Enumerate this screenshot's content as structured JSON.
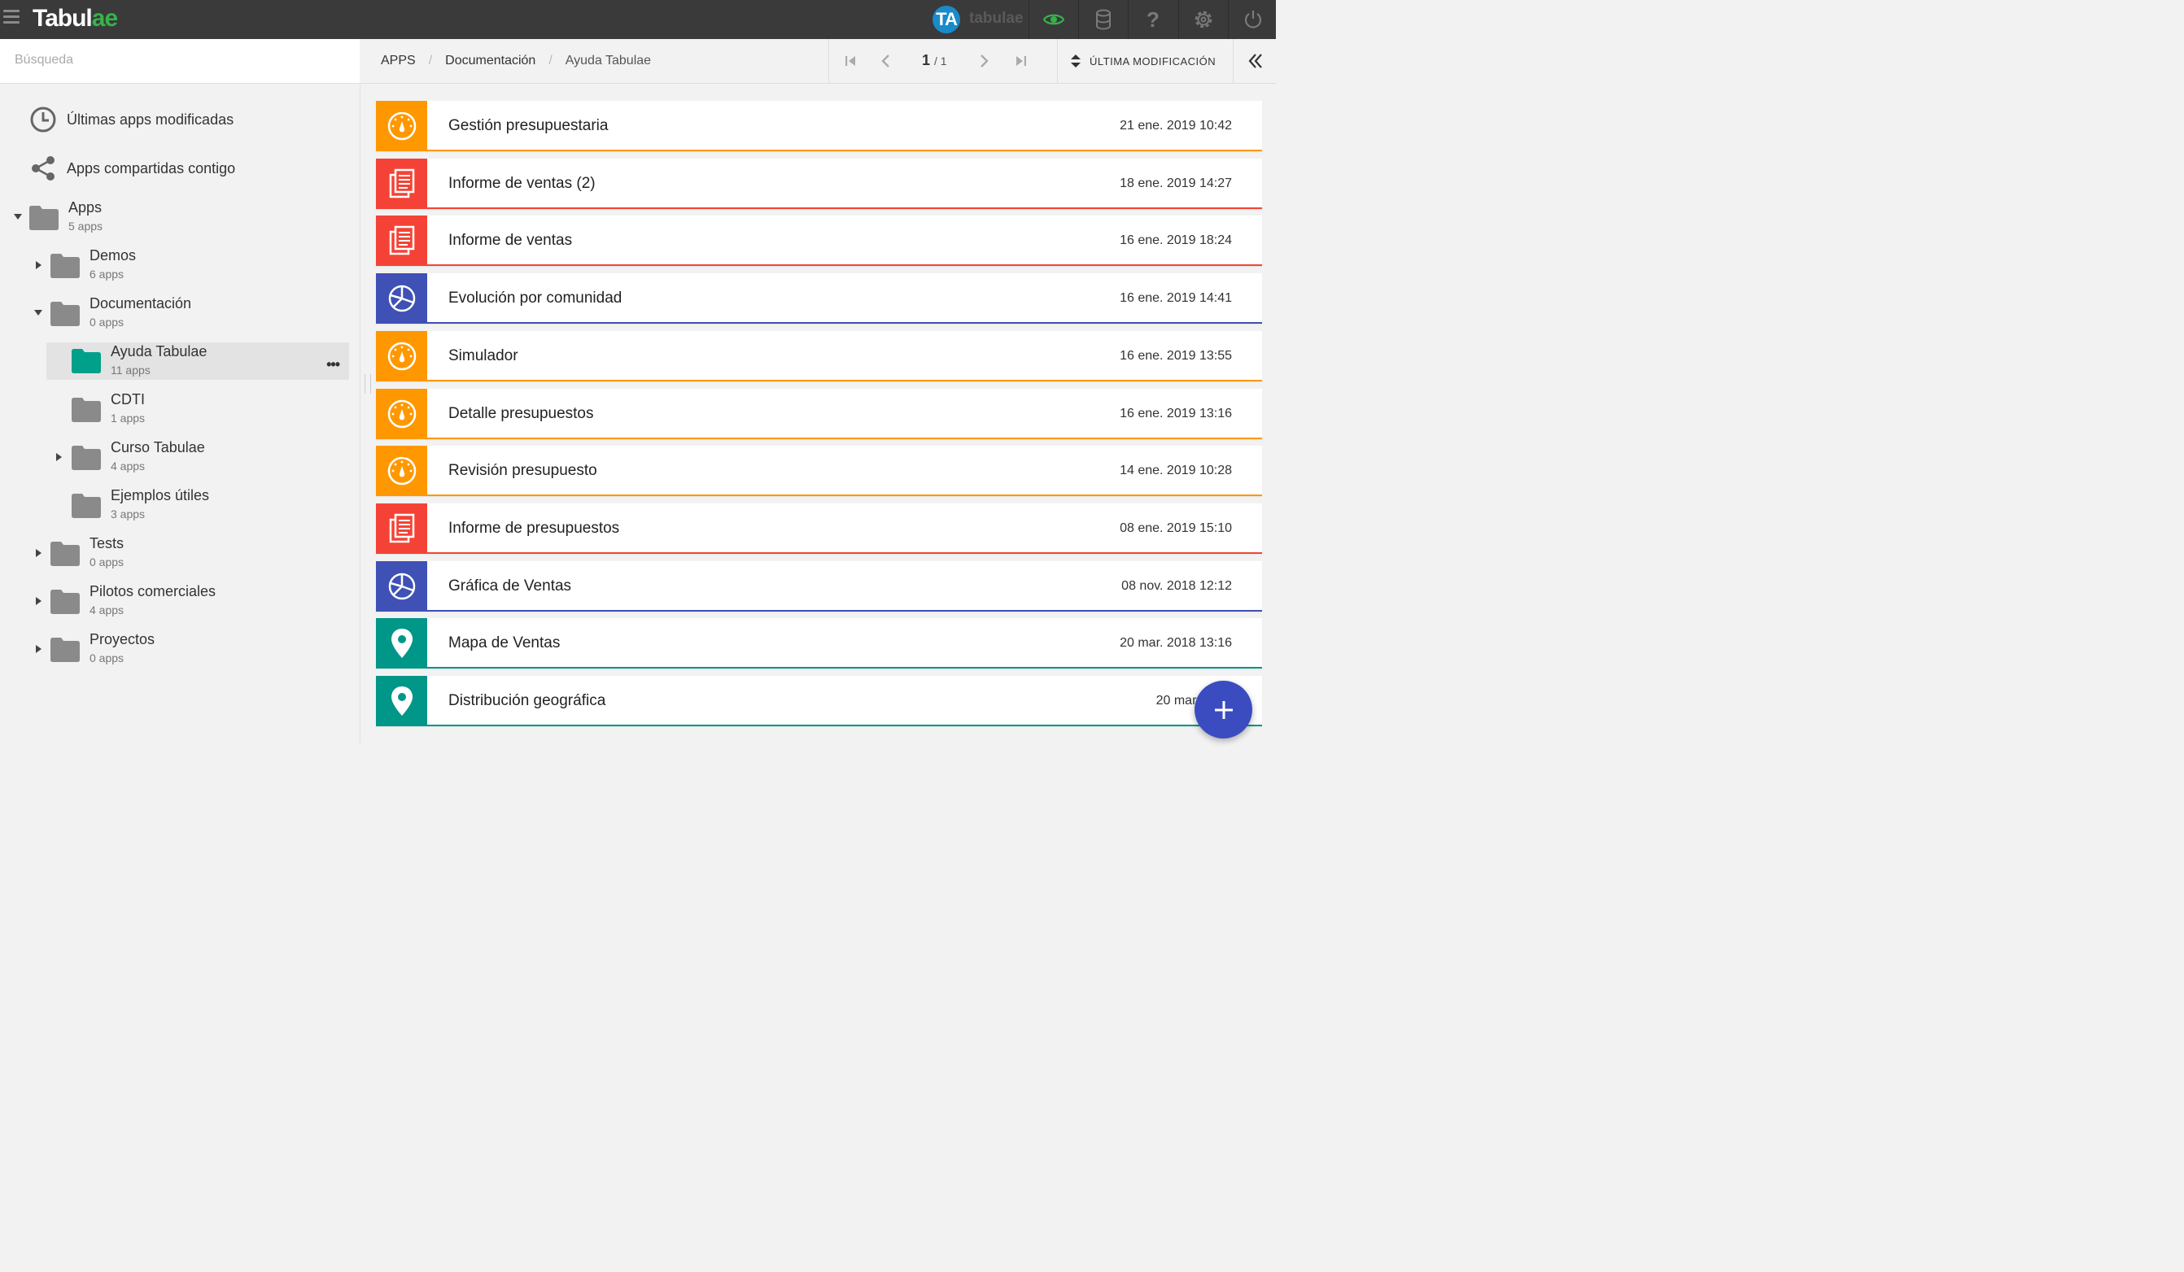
{
  "topbar": {
    "logo_main": "Tabul",
    "logo_accent": "ae",
    "user_initials": "TA",
    "user_name": "tabulae",
    "icons": [
      "menu-icon",
      "eye-icon",
      "database-icon",
      "help-icon",
      "settings-icon",
      "power-icon"
    ]
  },
  "search": {
    "placeholder": "Búsqueda",
    "value": ""
  },
  "breadcrumb": {
    "items": [
      "APPS",
      "Documentación",
      "Ayuda Tabulae"
    ],
    "separator": "/"
  },
  "pager": {
    "current": "1",
    "total": "/ 1"
  },
  "sort": {
    "label": "ÚLTIMA MODIFICACIÓN"
  },
  "sidebar": {
    "quick_links": [
      {
        "label": "Últimas apps modificadas",
        "icon": "clock-icon"
      },
      {
        "label": "Apps compartidas contigo",
        "icon": "share-icon"
      }
    ],
    "tree": [
      {
        "name": "Apps",
        "count": "5 apps",
        "expanded": true
      },
      {
        "name": "Demos",
        "count": "6 apps",
        "expanded": false
      },
      {
        "name": "Documentación",
        "count": "0 apps",
        "expanded": true
      },
      {
        "name": "Ayuda Tabulae",
        "count": "11 apps",
        "selected": true,
        "menu": "•••"
      },
      {
        "name": "CDTI",
        "count": "1 apps"
      },
      {
        "name": "Curso Tabulae",
        "count": "4 apps",
        "expanded": false
      },
      {
        "name": "Ejemplos útiles",
        "count": "3 apps"
      },
      {
        "name": "Tests",
        "count": "0 apps",
        "expanded": false
      },
      {
        "name": "Pilotos comerciales",
        "count": "4 apps",
        "expanded": false
      },
      {
        "name": "Proyectos",
        "count": "0 apps",
        "expanded": false
      }
    ]
  },
  "colors": {
    "orange": "#ff9800",
    "red": "#f44336",
    "indigo": "#3f51b5",
    "teal": "#009688",
    "selected_folder": "#00a08a",
    "folder": "#8a8a8a",
    "fab": "#3b4cc0"
  },
  "apps": [
    {
      "name": "Gestión presupuestaria",
      "date": "21 ene. 2019 10:42",
      "type": "gauge",
      "color": "#ff9800"
    },
    {
      "name": "Informe de ventas (2)",
      "date": "18 ene. 2019 14:27",
      "type": "report",
      "color": "#f44336"
    },
    {
      "name": "Informe de ventas",
      "date": "16 ene. 2019 18:24",
      "type": "report",
      "color": "#f44336"
    },
    {
      "name": "Evolución por comunidad",
      "date": "16 ene. 2019 14:41",
      "type": "pie",
      "color": "#3f51b5"
    },
    {
      "name": "Simulador",
      "date": "16 ene. 2019 13:55",
      "type": "gauge",
      "color": "#ff9800"
    },
    {
      "name": "Detalle presupuestos",
      "date": "16 ene. 2019 13:16",
      "type": "gauge",
      "color": "#ff9800"
    },
    {
      "name": "Revisión presupuesto",
      "date": "14 ene. 2019 10:28",
      "type": "gauge",
      "color": "#ff9800"
    },
    {
      "name": "Informe de presupuestos",
      "date": "08 ene. 2019 15:10",
      "type": "report",
      "color": "#f44336"
    },
    {
      "name": "Gráfica de Ventas",
      "date": "08 nov. 2018 12:12",
      "type": "pie",
      "color": "#3f51b5"
    },
    {
      "name": "Mapa de Ventas",
      "date": "20 mar. 2018 13:16",
      "type": "map",
      "color": "#009688"
    },
    {
      "name": "Distribución geográfica",
      "date": "20 mar. 2018",
      "type": "map",
      "color": "#009688"
    }
  ],
  "fab": {
    "icon": "plus-icon",
    "label": "+"
  }
}
